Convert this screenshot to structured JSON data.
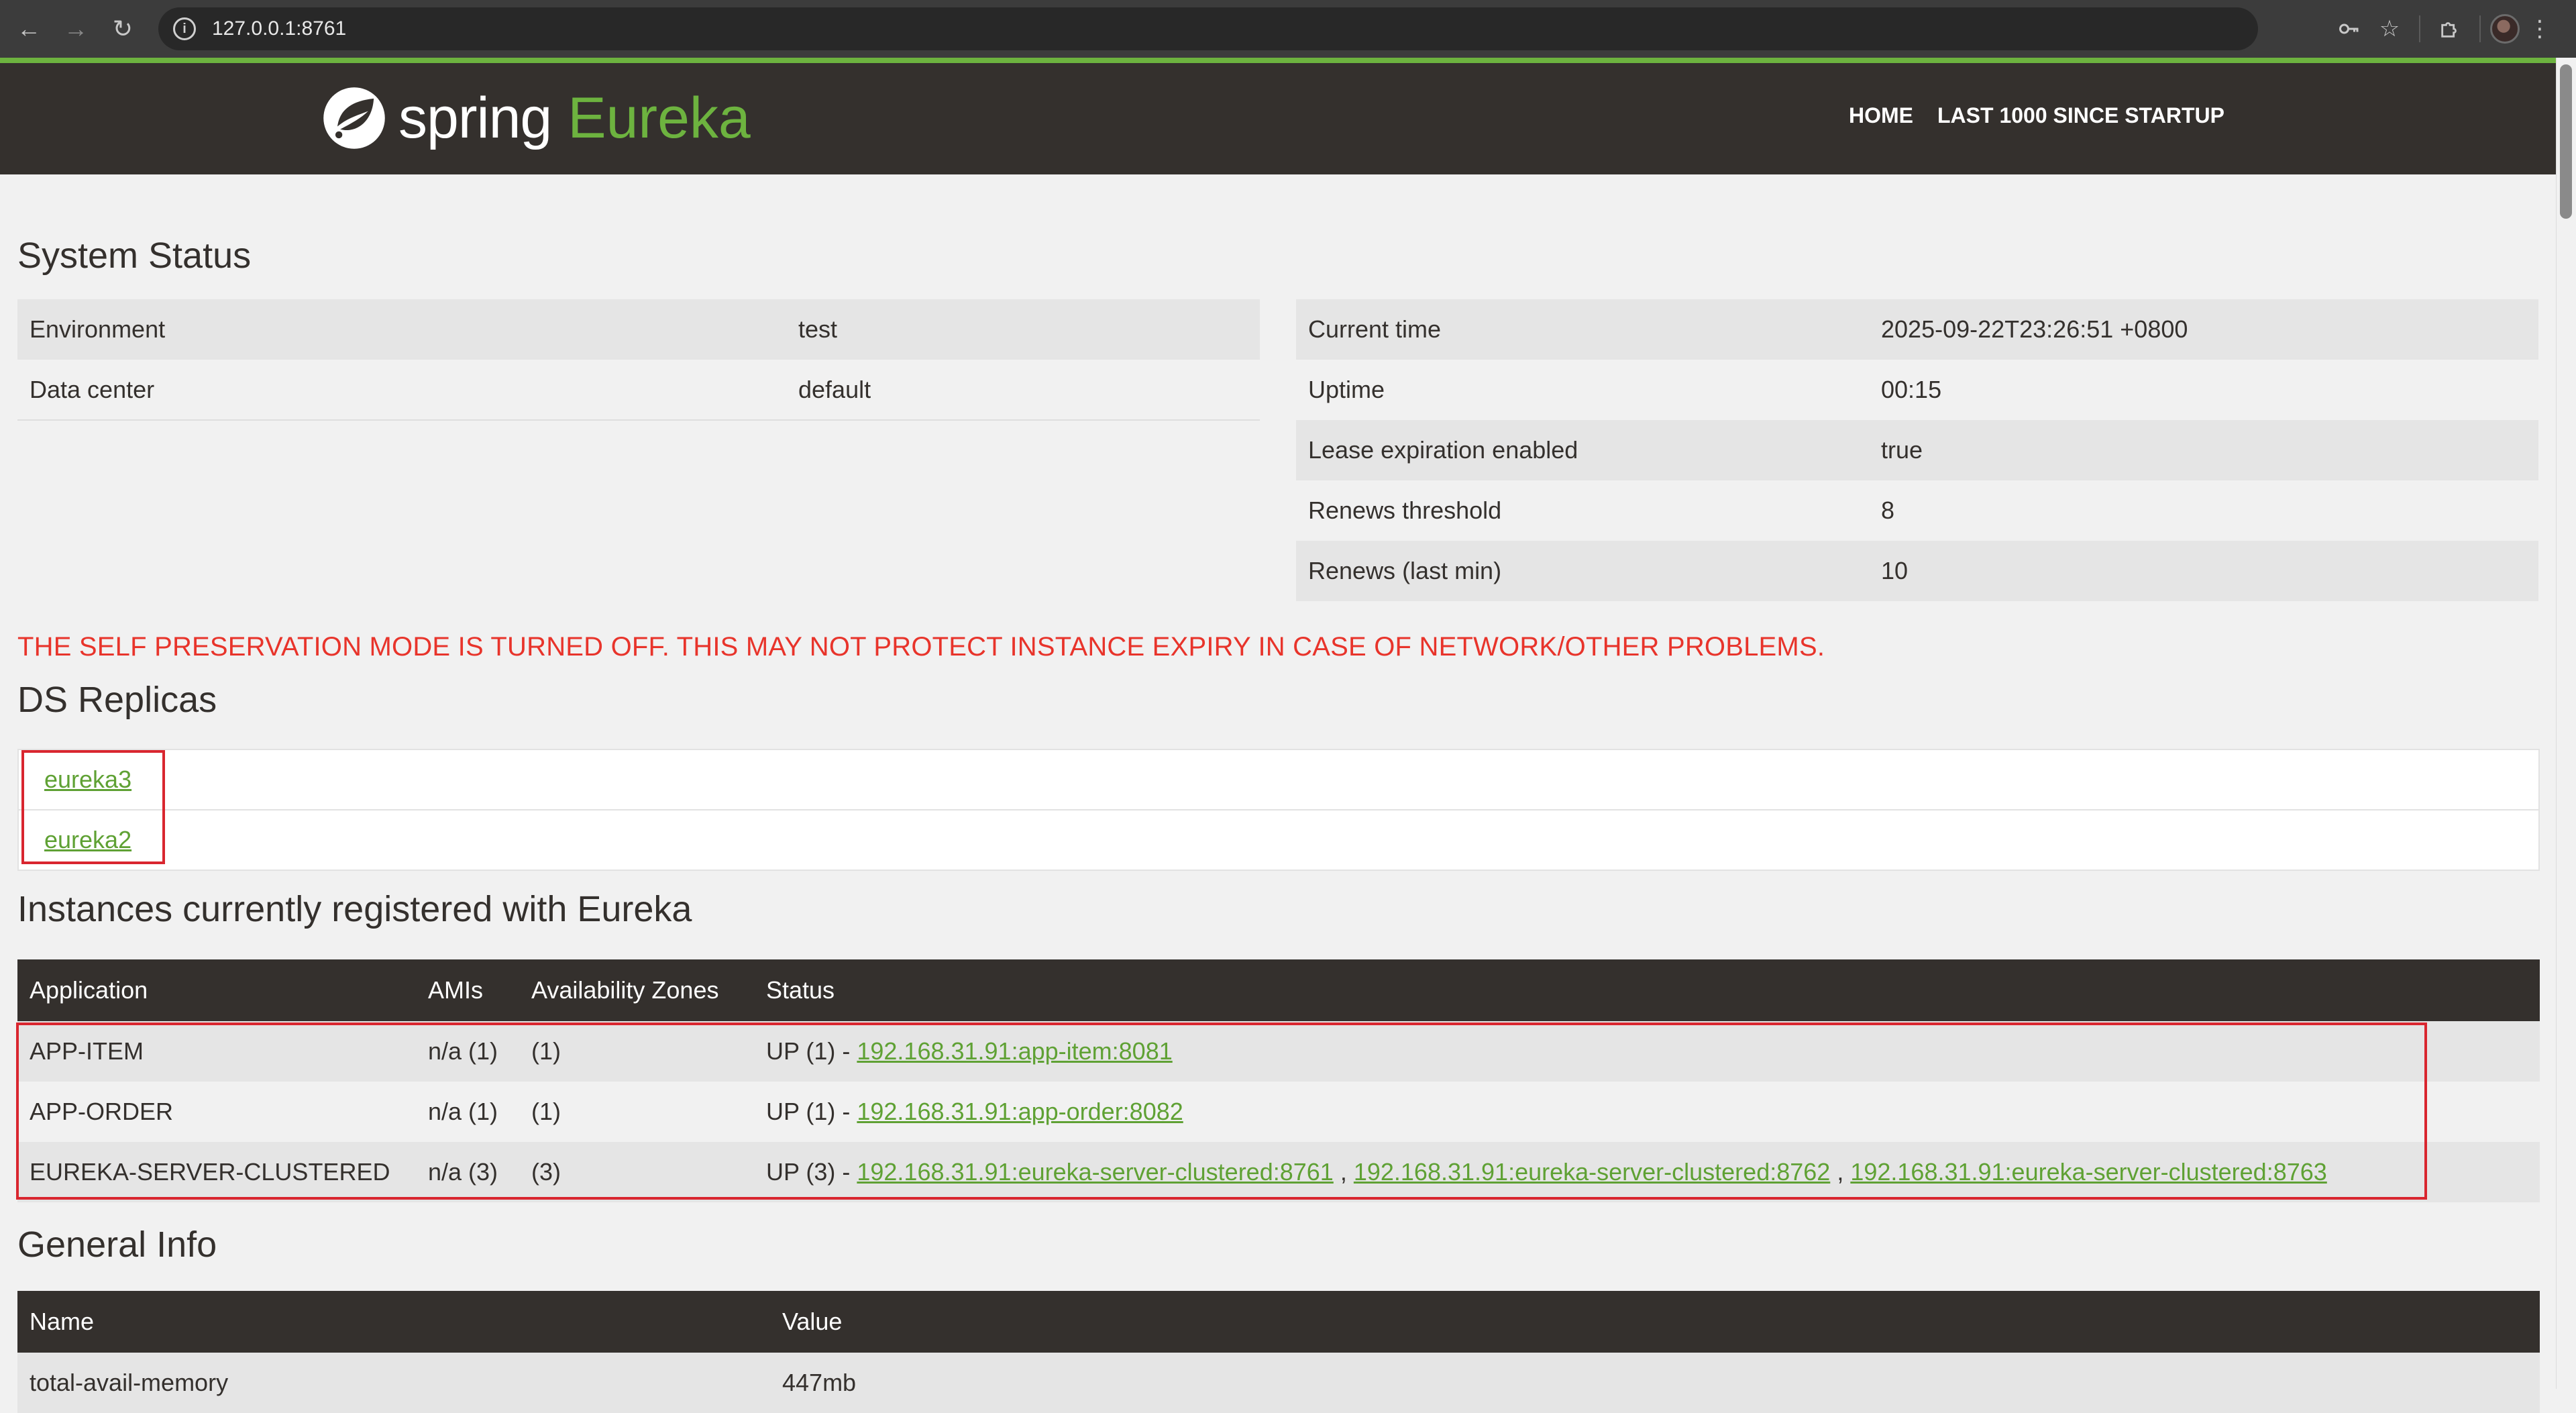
{
  "browser": {
    "url": "127.0.0.1:8761",
    "icons": {
      "back": "arrow-left-icon",
      "forward": "arrow-right-icon",
      "reload": "reload-icon",
      "site_info": "info-icon",
      "passwords": "key-icon",
      "bookmark": "star-icon",
      "extensions": "puzzle-icon",
      "menu": "kebab-menu-icon"
    }
  },
  "colors": {
    "brand_green": "#6db33f",
    "header_bg": "#34302d",
    "warning_red": "#e8342b",
    "link_green": "#5fa134",
    "highlight_box": "#d9262f"
  },
  "header": {
    "brand_spring": "spring",
    "brand_eureka": "Eureka",
    "nav": {
      "home": "HOME",
      "last1000": "LAST 1000 SINCE STARTUP"
    }
  },
  "system_status": {
    "title": "System Status",
    "left": [
      {
        "label": "Environment",
        "value": "test"
      },
      {
        "label": "Data center",
        "value": "default"
      }
    ],
    "right": [
      {
        "label": "Current time",
        "value": "2025-09-22T23:26:51 +0800"
      },
      {
        "label": "Uptime",
        "value": "00:15"
      },
      {
        "label": "Lease expiration enabled",
        "value": "true"
      },
      {
        "label": "Renews threshold",
        "value": "8"
      },
      {
        "label": "Renews (last min)",
        "value": "10"
      }
    ]
  },
  "warning": "THE SELF PRESERVATION MODE IS TURNED OFF. THIS MAY NOT PROTECT INSTANCE EXPIRY IN CASE OF NETWORK/OTHER PROBLEMS.",
  "ds_replicas": {
    "title": "DS Replicas",
    "items": [
      "eureka3",
      "eureka2"
    ]
  },
  "instances": {
    "title": "Instances currently registered with Eureka",
    "headers": [
      "Application",
      "AMIs",
      "Availability Zones",
      "Status"
    ],
    "rows": [
      {
        "application": "APP-ITEM",
        "amis": "n/a (1)",
        "zones": "(1)",
        "status_prefix": "UP (1) - ",
        "links": [
          "192.168.31.91:app-item:8081"
        ]
      },
      {
        "application": "APP-ORDER",
        "amis": "n/a (1)",
        "zones": "(1)",
        "status_prefix": "UP (1) - ",
        "links": [
          "192.168.31.91:app-order:8082"
        ]
      },
      {
        "application": "EUREKA-SERVER-CLUSTERED",
        "amis": "n/a (3)",
        "zones": "(3)",
        "status_prefix": "UP (3) - ",
        "links": [
          "192.168.31.91:eureka-server-clustered:8761",
          "192.168.31.91:eureka-server-clustered:8762",
          "192.168.31.91:eureka-server-clustered:8763"
        ],
        "separator": " , "
      }
    ]
  },
  "general_info": {
    "title": "General Info",
    "headers": [
      "Name",
      "Value"
    ],
    "rows": [
      {
        "name": "total-avail-memory",
        "value": "447mb"
      }
    ]
  }
}
